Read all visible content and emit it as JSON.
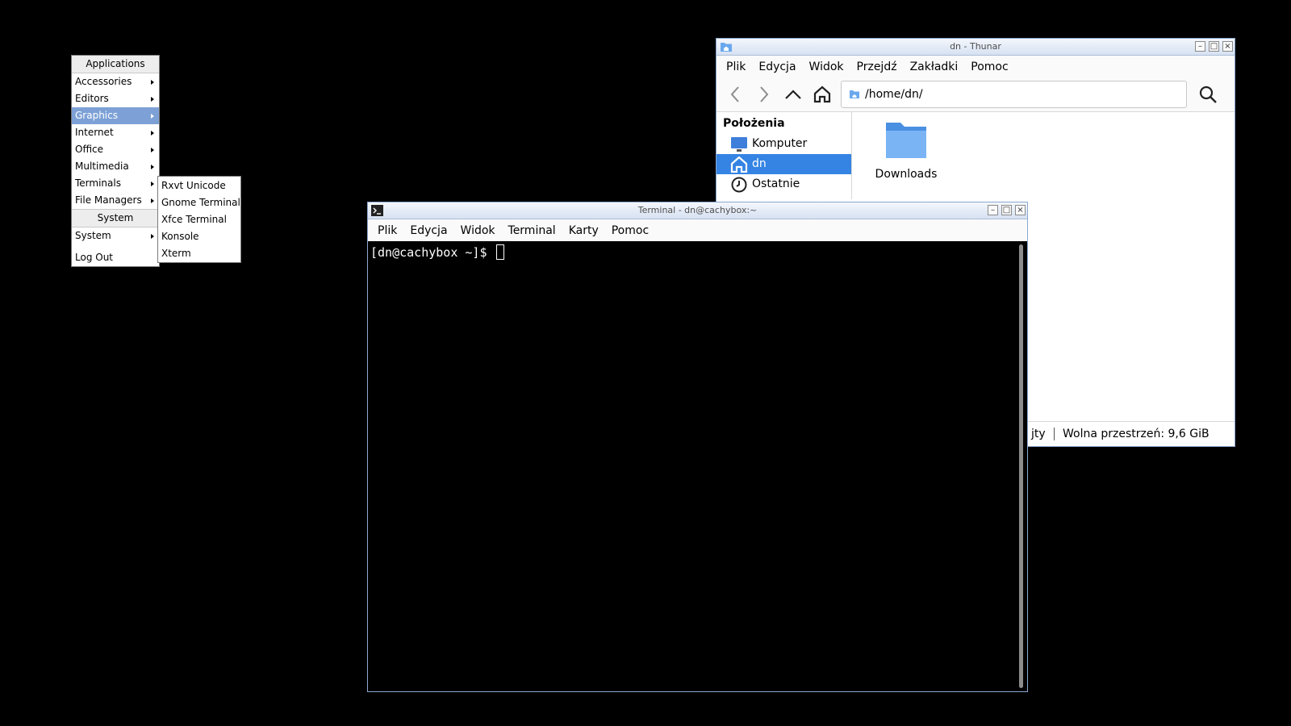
{
  "root_menu": {
    "header_apps": "Applications",
    "items": [
      {
        "label": "Accessories"
      },
      {
        "label": "Editors"
      },
      {
        "label": "Graphics"
      },
      {
        "label": "Internet"
      },
      {
        "label": "Office"
      },
      {
        "label": "Multimedia"
      },
      {
        "label": "Terminals"
      },
      {
        "label": "File Managers"
      }
    ],
    "header_system": "System",
    "system_item": "System",
    "logout": "Log Out"
  },
  "submenu_terminals": {
    "items": [
      "Rxvt Unicode",
      "Gnome Terminal",
      "Xfce Terminal",
      "Konsole",
      "Xterm"
    ]
  },
  "thunar": {
    "title": "dn - Thunar",
    "menu": [
      "Plik",
      "Edycja",
      "Widok",
      "Przejdź",
      "Zakładki",
      "Pomoc"
    ],
    "location": "/home/dn/",
    "sidebar_heading": "Położenia",
    "sidebar_items": [
      "Komputer",
      "dn",
      "Ostatnie"
    ],
    "folder": "Downloads",
    "status_left": "jty",
    "status_free": "Wolna przestrzeń: 9,6 GiB"
  },
  "terminal": {
    "title": "Terminal - dn@cachybox:~",
    "menu": [
      "Plik",
      "Edycja",
      "Widok",
      "Terminal",
      "Karty",
      "Pomoc"
    ],
    "prompt": "[dn@cachybox ~]$ "
  },
  "colors": {
    "selection": "#7da1d6",
    "sidebar_active": "#3584e4",
    "folder": "#5fa3ec"
  }
}
